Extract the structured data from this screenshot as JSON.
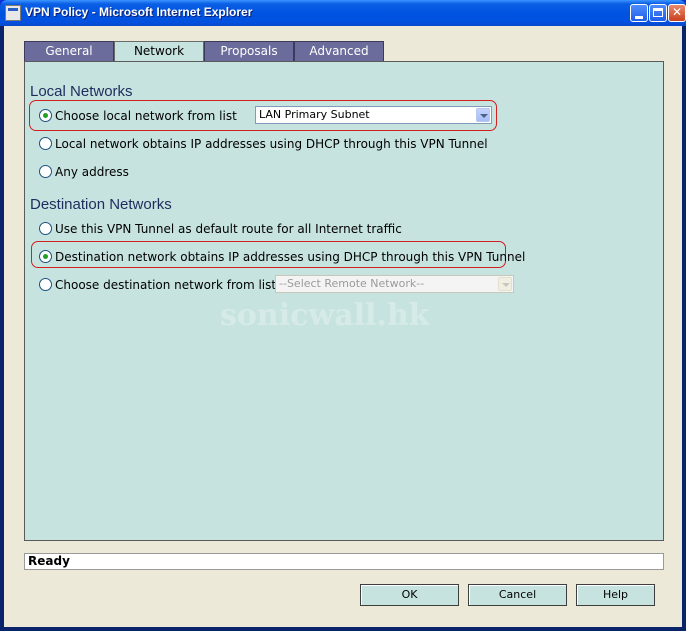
{
  "window": {
    "title": "VPN Policy - Microsoft Internet Explorer"
  },
  "tabs": [
    {
      "label": "General",
      "active": false
    },
    {
      "label": "Network",
      "active": true
    },
    {
      "label": "Proposals",
      "active": false
    },
    {
      "label": "Advanced",
      "active": false
    }
  ],
  "local_networks": {
    "title": "Local Networks",
    "options": [
      {
        "label": "Choose local network from list",
        "checked": true
      },
      {
        "label": "Local network obtains IP addresses using DHCP through this VPN Tunnel",
        "checked": false
      },
      {
        "label": "Any address",
        "checked": false
      }
    ],
    "select_value": "LAN Primary Subnet"
  },
  "destination_networks": {
    "title": "Destination Networks",
    "options": [
      {
        "label": "Use this VPN Tunnel as default route for all Internet traffic",
        "checked": false
      },
      {
        "label": "Destination network obtains IP addresses using DHCP through this VPN Tunnel",
        "checked": true
      },
      {
        "label": "Choose destination network from list",
        "checked": false
      }
    ],
    "select_value": "--Select Remote Network--"
  },
  "watermark": "sonicwall.hk",
  "status": "Ready",
  "buttons": {
    "ok": "OK",
    "cancel": "Cancel",
    "help": "Help"
  },
  "colors": {
    "panel": "#c7e3e0",
    "tab_inactive": "#6b6c9c",
    "section_title": "#1b2e5d",
    "highlight": "#d02020"
  }
}
